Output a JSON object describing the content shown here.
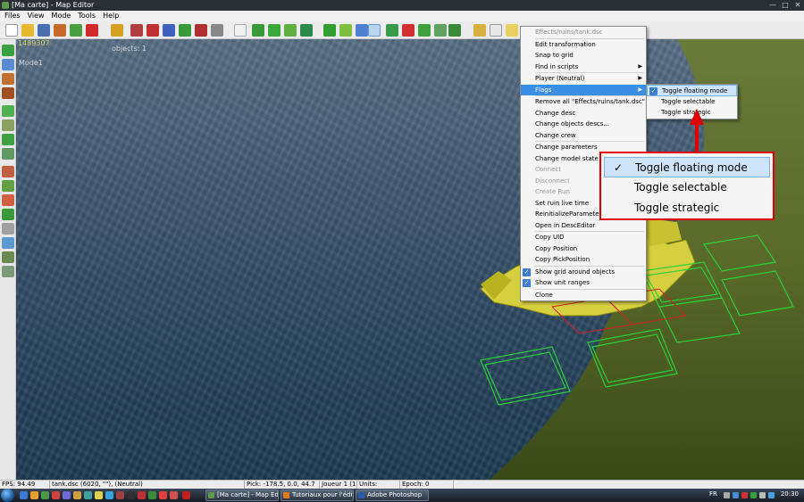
{
  "window": {
    "title": "[Ma carte] - Map Editor"
  },
  "menubar": [
    "Files",
    "View",
    "Mode",
    "Tools",
    "Help"
  ],
  "viewport": {
    "id_label": "1489307",
    "mode_label": "Mode1",
    "objects_label": "objects: 1"
  },
  "context_menu": {
    "header": "Effects/ruins/tank.dsc",
    "edit_transformation": "Edit transformation",
    "snap_to_grid": "Snap to grid",
    "find_in_scripts": "Find in scripts",
    "player": "Player (Neutral)",
    "flags": "Flags",
    "remove_all": "Remove all \"Effects/ruins/tank.dsc\"",
    "change_desc": "Change desc",
    "change_objects_descs": "Change objects descs...",
    "change_crew": "Change crew",
    "change_parameters": "Change parameters",
    "change_model_state": "Change model state",
    "connect": "Connect",
    "disconnect": "Disconnect",
    "create_run": "Create Run",
    "set_ruin_live_time": "Set ruin live time",
    "reinitialize_parameters": "ReinitializeParameters",
    "open_in_desc_editor": "Open in DescEditor",
    "copy_uid": "Copy UID",
    "copy_position": "Copy Position",
    "copy_pick_position": "Copy PickPosition",
    "show_grid_around_objects": "Show grid around objects",
    "show_unit_ranges": "Show unit ranges",
    "clone": "Clone"
  },
  "flags_submenu": {
    "toggle_floating_mode": "Toggle floating mode",
    "toggle_selectable": "Toggle selectable",
    "toggle_strategic": "Toggle strategic"
  },
  "statusbar": {
    "fps": "FPS: 94.49",
    "selection": "tank.dsc (6020, \"\"), (Neutral)",
    "pick": "Pick: -178.5, 0.0, 44.7",
    "player": "Joueur 1 (1)",
    "units": "Units:",
    "epoch": "Epoch: 0"
  },
  "taskbar": {
    "tasks": [
      "[Ma carte] - Map Ed...",
      "Tutoriaux pour l'édit...",
      "Adobe Photoshop"
    ],
    "lang": "FR",
    "clock": "20:30"
  },
  "icons": {
    "check": "✓",
    "submenu_arrow": "▶",
    "minimize": "—",
    "maximize": "□",
    "close": "✕"
  },
  "colors": {
    "highlight": "#3a8ee6",
    "callout_border": "#e00000",
    "grid_green": "#2ad03a",
    "grid_red": "#d02020"
  }
}
